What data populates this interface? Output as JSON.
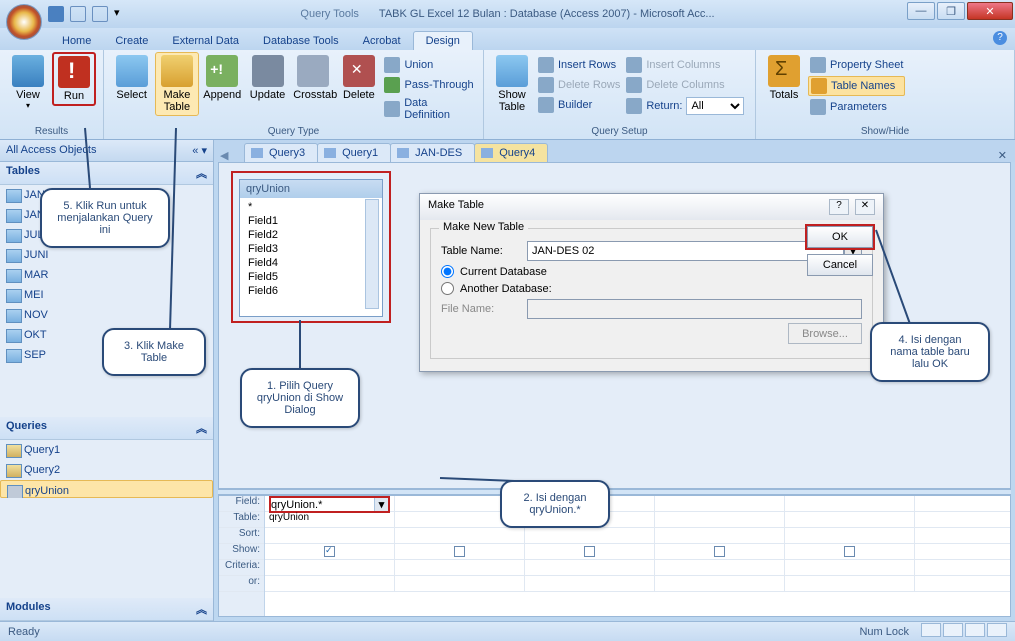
{
  "title": {
    "query_tools": "Query Tools",
    "doc": "TABK GL Excel 12 Bulan : Database (Access 2007) - Microsoft Acc..."
  },
  "tabs": {
    "home": "Home",
    "create": "Create",
    "external": "External Data",
    "dbtools": "Database Tools",
    "acrobat": "Acrobat",
    "design": "Design"
  },
  "ribbon": {
    "results": "Results",
    "querytype": "Query Type",
    "querysetup": "Query Setup",
    "showhide": "Show/Hide",
    "view": "View",
    "run": "Run",
    "select": "Select",
    "make": "Make\nTable",
    "append": "Append",
    "update": "Update",
    "crosstab": "Crosstab",
    "delete": "Delete",
    "union": "Union",
    "passthrough": "Pass-Through",
    "datadef": "Data Definition",
    "show": "Show\nTable",
    "insertrows": "Insert Rows",
    "deleterows": "Delete Rows",
    "builder": "Builder",
    "insertcols": "Insert Columns",
    "deletecols": "Delete Columns",
    "return": "Return:",
    "returnval": "All",
    "totals": "Totals",
    "propsheet": "Property Sheet",
    "tablenames": "Table Names",
    "params": "Parameters"
  },
  "nav": {
    "header": "All Access Objects",
    "tables_h": "Tables",
    "tables": [
      "JAN",
      "JAN-DES",
      "JULI",
      "JUNI",
      "MAR",
      "MEI",
      "NOV",
      "OKT",
      "SEP"
    ],
    "queries_h": "Queries",
    "queries": [
      "Query1",
      "Query2",
      "qryUnion"
    ],
    "modules_h": "Modules"
  },
  "wtabs": [
    "Query3",
    "Query1",
    "JAN-DES",
    "Query4"
  ],
  "qbox": {
    "title": "qryUnion",
    "fields": [
      "*",
      "Field1",
      "Field2",
      "Field3",
      "Field4",
      "Field5",
      "Field6"
    ]
  },
  "dialog": {
    "title": "Make Table",
    "group": "Make New Table",
    "tablename_l": "Table Name:",
    "tablename_v": "JAN-DES 02",
    "current": "Current Database",
    "another": "Another Database:",
    "filename": "File Name:",
    "browse": "Browse...",
    "ok": "OK",
    "cancel": "Cancel"
  },
  "qbe": {
    "labels": [
      "Field:",
      "Table:",
      "Sort:",
      "Show:",
      "Criteria:",
      "or:"
    ],
    "field": "qryUnion.*",
    "table": "qryUnion"
  },
  "status": {
    "ready": "Ready",
    "numlock": "Num Lock"
  },
  "callouts": {
    "c1": "1. Pilih Query qryUnion di Show Dialog",
    "c2": "2. Isi dengan qryUnion.*",
    "c3": "3. Klik Make Table",
    "c4": "4. Isi dengan nama table baru lalu OK",
    "c5": "5. Klik Run untuk menjalankan Query ini"
  }
}
